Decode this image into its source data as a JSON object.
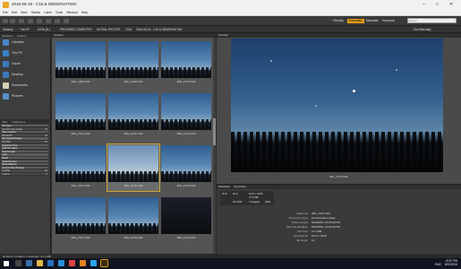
{
  "window": {
    "title": "2016-08-19 - C15 & OBSERVATION",
    "minimize": "–",
    "maximize": "□",
    "close": "✕"
  },
  "menu": [
    "File",
    "Edit",
    "View",
    "Stacks",
    "Label",
    "Tools",
    "Window",
    "Help"
  ],
  "workspaces": [
    "Filmstrip",
    "Essentials",
    "Metadata",
    "Keywords"
  ],
  "active_workspace": "Essentials",
  "search": {
    "placeholder": "Search"
  },
  "path": [
    "Desktop",
    "This PC",
    "DATA (D:)",
    "PROVIDED COMPUTER",
    "DIGITAL PHOTOS",
    "2016",
    "2016-08-19 - C15 & OBSERVATION"
  ],
  "sort": {
    "label": "Sort Manually"
  },
  "left": {
    "tabs": [
      "Favorites",
      "Folders"
    ],
    "favorites": [
      {
        "label": "Libraries",
        "color": "#4a86c5"
      },
      {
        "label": "This PC",
        "color": "#3a7fc0"
      },
      {
        "label": "Travel",
        "color": "#3d79b8"
      },
      {
        "label": "Desktop",
        "color": "#3d79b8"
      },
      {
        "label": "Documents",
        "color": "#d6d0b4"
      },
      {
        "label": "Pictures",
        "color": "#5b8fc8"
      }
    ],
    "filter_tabs": [
      "Filter",
      "Collections"
    ],
    "filters": [
      {
        "label": "File Type",
        "count": "",
        "header": true
      },
      {
        "label": "Camera Raw image",
        "count": "20"
      },
      {
        "label": "Date Created",
        "count": "",
        "header": true
      },
      {
        "label": "8/19/2016",
        "count": "20"
      },
      {
        "label": "ISO Speed Ratings",
        "count": "",
        "header": true
      },
      {
        "label": "ISO 800",
        "count": "20"
      },
      {
        "label": "Exposure Time",
        "count": "",
        "header": true
      },
      {
        "label": "Aperture Value",
        "count": "",
        "header": true
      },
      {
        "label": "Focal Length",
        "count": "",
        "header": true
      },
      {
        "label": "Lens",
        "count": "",
        "header": true
      },
      {
        "label": "Model",
        "count": "",
        "header": true
      },
      {
        "label": "Serial Number",
        "count": "",
        "header": true
      },
      {
        "label": "White Balance",
        "count": "",
        "header": true
      },
      {
        "label": "Camera Raw Settings",
        "count": "",
        "header": true
      },
      {
        "label": "As Shot",
        "count": "20"
      },
      {
        "label": "Custom",
        "count": "0"
      }
    ]
  },
  "content": {
    "tabs": [
      "Content"
    ],
    "thumbs": [
      {
        "name": "IMG_1268.CR2",
        "style": "normal"
      },
      {
        "name": "IMG_1269.CR2",
        "style": "normal"
      },
      {
        "name": "IMG_1270.CR2",
        "style": "normal"
      },
      {
        "name": "IMG_1271.CR2",
        "style": "normal"
      },
      {
        "name": "IMG_1272.CR2",
        "style": "normal"
      },
      {
        "name": "IMG_1273.CR2",
        "style": "normal"
      },
      {
        "name": "IMG_1274.CR2",
        "style": "normal"
      },
      {
        "name": "IMG_1275.CR2",
        "style": "sel"
      },
      {
        "name": "IMG_1276.CR2",
        "style": "normal"
      },
      {
        "name": "IMG_1277.CR2",
        "style": "normal"
      },
      {
        "name": "IMG_1278.CR2",
        "style": "normal"
      },
      {
        "name": "IMG_1279.CR2",
        "style": "dark"
      }
    ]
  },
  "preview": {
    "tab": "Preview",
    "caption": "IMG_1275.CR2"
  },
  "metadata": {
    "tabs": [
      "Metadata",
      "Keywords"
    ],
    "rows": [
      {
        "k": "Filename",
        "v": "IMG_1275.CR2"
      },
      {
        "k": "Document Type",
        "v": "Camera Raw image"
      },
      {
        "k": "Date Created",
        "v": "8/19/2016, 10:25:40 PM"
      },
      {
        "k": "Date File Modified",
        "v": "8/19/2016, 10:25:40 PM"
      },
      {
        "k": "File Size",
        "v": "27.4 MB"
      },
      {
        "k": "Dimensions",
        "v": "5472 x 3648"
      },
      {
        "k": "Bit Depth",
        "v": "16"
      }
    ],
    "camera": [
      "f/2.8",
      "30.0",
      "ISO 800",
      "5472 x 3648",
      "27.4 MB",
      "Untagged",
      "RGB"
    ]
  },
  "status": {
    "text": "20 items, 1 hidden, 1 selected - 27.4 MB"
  },
  "taskbar": {
    "time": "10:57 PM",
    "date": "8/22/2016",
    "lang": "ENG"
  },
  "colors": {
    "accent": "#e09b1a",
    "selection": "#c9a530"
  }
}
